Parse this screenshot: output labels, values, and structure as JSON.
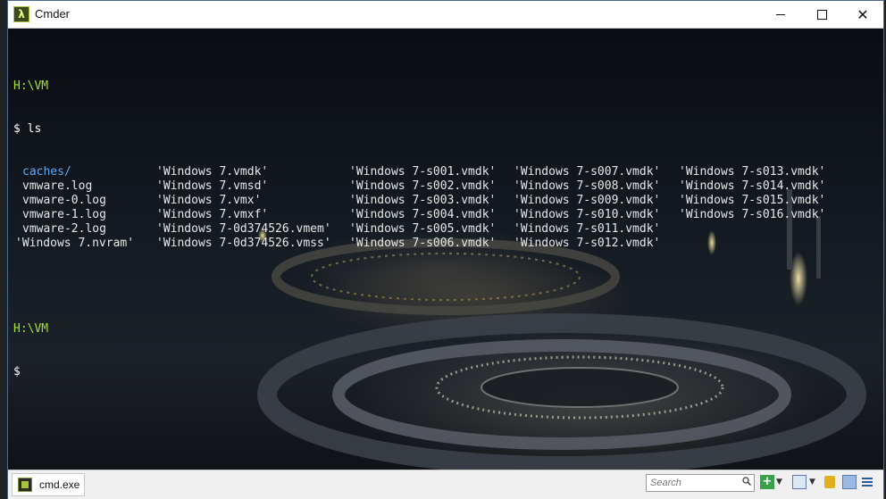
{
  "window": {
    "title": "Cmder",
    "app_icon": "λ"
  },
  "terminal": {
    "prompt_path": "H:\\VM",
    "prompt_sign": "$",
    "command": "ls",
    "listing": [
      [
        "caches/",
        "'Windows 7.vmdk'",
        "'Windows 7-s001.vmdk'",
        "'Windows 7-s007.vmdk'",
        "'Windows 7-s013.vmdk'"
      ],
      [
        "vmware.log",
        "'Windows 7.vmsd'",
        "'Windows 7-s002.vmdk'",
        "'Windows 7-s008.vmdk'",
        "'Windows 7-s014.vmdk'"
      ],
      [
        "vmware-0.log",
        "'Windows 7.vmx'",
        "'Windows 7-s003.vmdk'",
        "'Windows 7-s009.vmdk'",
        "'Windows 7-s015.vmdk'"
      ],
      [
        "vmware-1.log",
        "'Windows 7.vmxf'",
        "'Windows 7-s004.vmdk'",
        "'Windows 7-s010.vmdk'",
        "'Windows 7-s016.vmdk'"
      ],
      [
        "vmware-2.log",
        "'Windows 7-0d374526.vmem'",
        "'Windows 7-s005.vmdk'",
        "'Windows 7-s011.vmdk'",
        ""
      ],
      [
        "'Windows 7.nvram'",
        "'Windows 7-0d374526.vmss'",
        "'Windows 7-s006.vmdk'",
        "'Windows 7-s012.vmdk'",
        ""
      ]
    ],
    "colors": {
      "path": "#a3e03a",
      "directory": "#5aaaf0",
      "text": "#e8e8e8"
    }
  },
  "statusbar": {
    "tab_label": "cmd.exe",
    "search_placeholder": "Search"
  }
}
